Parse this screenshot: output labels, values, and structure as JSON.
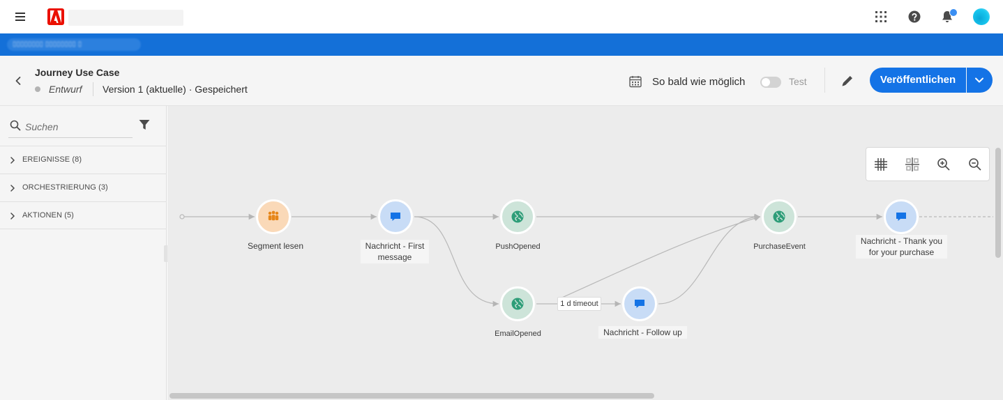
{
  "topbar": {
    "menu_icon": "hamburger-icon",
    "logo_icon": "adobe-logo",
    "apps_icon": "apps-grid-icon",
    "help_icon": "help-icon",
    "bell_icon": "bell-icon",
    "avatar_color": "#19c7ef"
  },
  "colors": {
    "accent": "#1473e6",
    "sandbox_bar": "#1470d8",
    "segment_node": "#fad9b8",
    "message_node": "#c8dcf6",
    "event_node": "#cde4d9"
  },
  "journey": {
    "title": "Journey Use Case",
    "status": "Entwurf",
    "version": "Version 1 (aktuelle) · Gespeichert",
    "schedule": "So bald wie möglich",
    "test_label": "Test",
    "test_enabled": false,
    "publish_label": "Veröffentlichen"
  },
  "sidebar": {
    "search_placeholder": "Suchen",
    "categories": [
      {
        "label": "EREIGNISSE",
        "count": "(8)"
      },
      {
        "label": "ORCHESTRIERUNG",
        "count": "(3)"
      },
      {
        "label": "AKTIONEN",
        "count": "(5)"
      }
    ]
  },
  "canvas": {
    "nodes": {
      "segment": {
        "label": "Segment lesen",
        "icon": "people-icon"
      },
      "first_message": {
        "label_line1": "Nachricht - First",
        "label_line2": "message",
        "icon": "chat-bubble-icon"
      },
      "push_opened": {
        "label": "PushOpened",
        "icon": "globe-icon"
      },
      "email_opened": {
        "label": "EmailOpened",
        "icon": "globe-icon"
      },
      "follow_up": {
        "label": "Nachricht - Follow up",
        "icon": "chat-bubble-icon"
      },
      "purchase_event": {
        "label": "PurchaseEvent",
        "icon": "globe-icon"
      },
      "thank_you": {
        "label_line1": "Nachricht - Thank you",
        "label_line2": "for your purchase",
        "icon": "chat-bubble-icon"
      }
    },
    "timeout_label": "1 d timeout",
    "tools": [
      "grid-icon",
      "fit-to-screen-icon",
      "zoom-in-icon",
      "zoom-out-icon"
    ]
  }
}
